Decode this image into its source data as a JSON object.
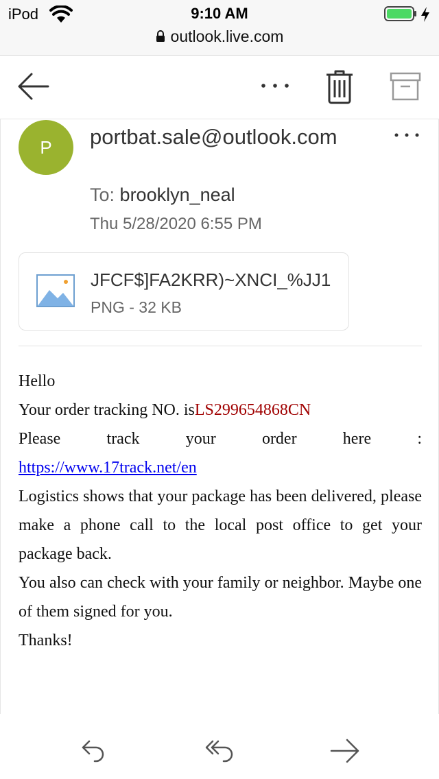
{
  "status_bar": {
    "carrier": "iPod",
    "time": "9:10 AM",
    "url": "outlook.live.com"
  },
  "toolbar": {
    "icons": [
      "back-arrow-icon",
      "more-icon",
      "delete-icon",
      "archive-icon"
    ]
  },
  "message": {
    "avatar_initial": "P",
    "avatar_color": "#9ab32f",
    "sender": "portbat.sale@outlook.com",
    "to_label": "To:",
    "to_value": "brooklyn_neal",
    "date": "Thu 5/28/2020 6:55 PM",
    "attachment": {
      "name": "JFCF$]FA2KRR)~XNCI_%JJ1",
      "meta": "PNG - 32 KB"
    },
    "body": {
      "greeting": "Hello",
      "tracking_prefix": "Your order tracking NO. is",
      "tracking_number": "LS299654868CN",
      "tracking_color": "#a00000",
      "track_line": "Please track your order here :",
      "track_link": "https://www.17track.net/en",
      "delivered": "Logistics shows that your package has been delivered, please make a phone call to the local post office to get your package back.",
      "check": "You also can check with your family or neighbor. Maybe one of them signed for you.",
      "closing": "Thanks!"
    }
  },
  "bottom_bar": {
    "icons": [
      "reply-icon",
      "reply-all-icon",
      "forward-icon"
    ]
  }
}
